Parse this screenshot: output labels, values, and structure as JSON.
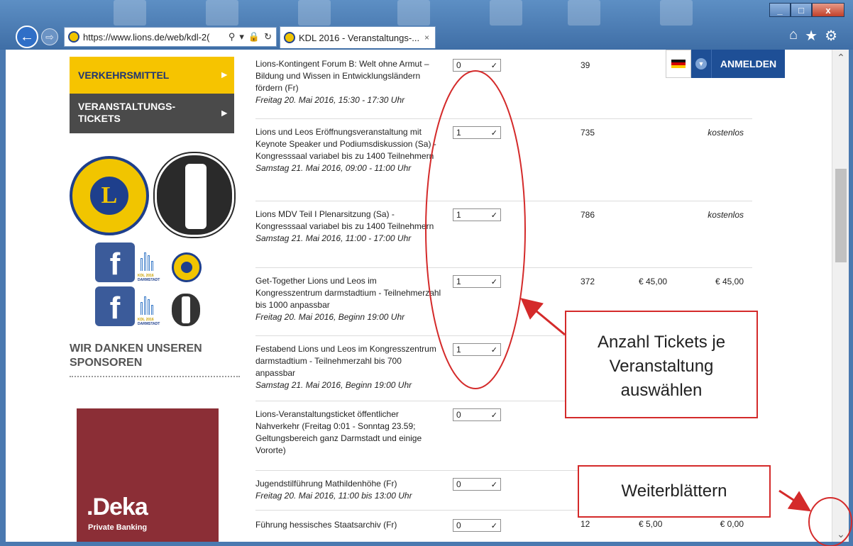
{
  "browser": {
    "url": "https://www.lions.de/web/kdl-2(",
    "tab_title": "KDL 2016 - Veranstaltungs-...",
    "tab_close": "×",
    "win_min": "_",
    "win_max": "□",
    "win_close": "x",
    "back_glyph": "←",
    "forward_glyph": "⇨",
    "icons": [
      "search-icon",
      "lock-icon",
      "refresh-icon",
      "home-icon",
      "favorites-star-icon",
      "settings-gear-icon"
    ]
  },
  "sidebar": {
    "items": [
      {
        "label": "VERKEHRSMITTEL",
        "color": "#f6c400"
      },
      {
        "label": "VERANSTALTUNGS-TICKETS",
        "color": "#4a4a4a"
      }
    ],
    "lions_letter": "L",
    "fb_letter": "f",
    "kdl_text": "KDL 2016",
    "kdl_city": "DARMSTADT",
    "sponsors_heading": "WIR DANKEN UNSEREN SPONSOREN",
    "sponsor_name": "Deka",
    "sponsor_subtitle": "Private Banking"
  },
  "header": {
    "login_label": "ANMELDEN",
    "flag": "german-flag-icon"
  },
  "events": [
    {
      "title": "Lions-Kontingent Forum B: Welt ohne Armut – Bildung und Wissen in Entwicklungsländern fördern (Fr)",
      "date": "Freitag 20. Mai 2016, 15:30 - 17:30 Uhr",
      "qty": "0",
      "count": "39",
      "price": "",
      "total": ""
    },
    {
      "title": "Lions und Leos Eröffnungsveranstaltung mit Keynote Speaker und Podiumsdiskussion (Sa) - Kongresssaal variabel bis zu 1400 Teilnehmern",
      "date": "Samstag 21. Mai 2016, 09:00 - 11:00 Uhr",
      "qty": "1",
      "count": "735",
      "price": "",
      "total": "kostenlos"
    },
    {
      "title": "Lions MDV Teil I Plenarsitzung (Sa) - Kongresssaal variabel bis zu 1400 Teilnehmern",
      "date": "Samstag 21. Mai 2016, 11:00 - 17:00 Uhr",
      "qty": "1",
      "count": "786",
      "price": "",
      "total": "kostenlos"
    },
    {
      "title": "Get-Together Lions und Leos im Kongresszentrum darmstadtium - Teilnehmerzahl bis 1000 anpassbar",
      "date": "Freitag 20. Mai 2016, Beginn 19:00 Uhr",
      "qty": "1",
      "count": "372",
      "price": "€ 45,00",
      "total": "€ 45,00"
    },
    {
      "title": "Festabend Lions und Leos im Kongresszentrum darmstadtium - Teilnehmerzahl bis 700 anpassbar",
      "date": "Samstag 21. Mai 2016, Beginn 19:00 Uhr",
      "qty": "1",
      "count": "",
      "price": "",
      "total": ""
    },
    {
      "title": "Lions-Veranstaltungsticket öffentlicher Nahverkehr (Freitag 0:01 - Sonntag 23.59; Geltungsbereich ganz Darmstadt und einige Vororte)",
      "date": "",
      "qty": "0",
      "count": "",
      "price": "",
      "total": ""
    },
    {
      "title": "Jugendstilführung Mathildenhöhe (Fr)",
      "date": "Freitag 20. Mai 2016, 11:00 bis 13:00 Uhr",
      "qty": "0",
      "count": "",
      "price": "",
      "total": ""
    },
    {
      "title": "Führung hessisches Staatsarchiv (Fr)",
      "date": "",
      "qty": "0",
      "count": "12",
      "price": "€ 5,00",
      "total": "€ 0,00"
    }
  ],
  "annotations": {
    "tickets_callout": "Anzahl Tickets je Veranstaltung auswählen",
    "scroll_callout": "Weiterblättern",
    "color": "#d42a2a"
  }
}
